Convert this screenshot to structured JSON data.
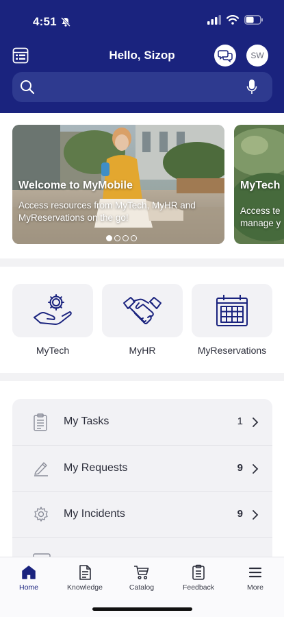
{
  "status_bar": {
    "time": "4:51"
  },
  "header": {
    "greeting": "Hello, Sizop",
    "avatar_initials": "SW",
    "search_placeholder": "",
    "background_color": "#1a237e"
  },
  "carousel": {
    "slides": [
      {
        "title": "Welcome to MyMobile",
        "description": "Access resources from MyTech, MyHR and MyReservations on the go!"
      },
      {
        "title": "MyTech",
        "description": "Access te\nmanage y"
      }
    ],
    "dot_count": 4,
    "active_index": 0
  },
  "apps": [
    {
      "label": "MyTech",
      "icon": "gear-hand-icon"
    },
    {
      "label": "MyHR",
      "icon": "handshake-icon"
    },
    {
      "label": "MyReservations",
      "icon": "calendar-icon"
    }
  ],
  "list": {
    "rows": [
      {
        "label": "My Tasks",
        "count": "1",
        "icon": "clipboard-icon"
      },
      {
        "label": "My Requests",
        "count": "9",
        "icon": "pencil-icon"
      },
      {
        "label": "My Incidents",
        "count": "9",
        "icon": "gear-icon"
      }
    ]
  },
  "tabbar": {
    "tabs": [
      {
        "label": "Home",
        "icon": "home-icon",
        "active": true
      },
      {
        "label": "Knowledge",
        "icon": "document-icon",
        "active": false
      },
      {
        "label": "Catalog",
        "icon": "cart-icon",
        "active": false
      },
      {
        "label": "Feedback",
        "icon": "clipboard-icon",
        "active": false
      },
      {
        "label": "More",
        "icon": "hamburger-icon",
        "active": false
      }
    ]
  }
}
